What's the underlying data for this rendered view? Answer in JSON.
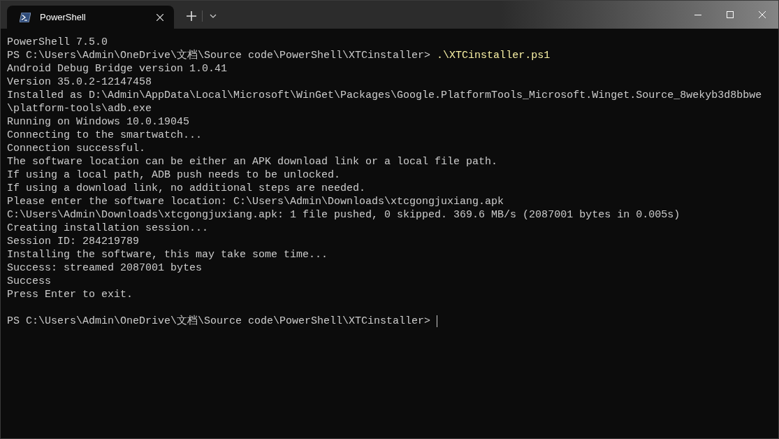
{
  "tabs": [
    {
      "title": "PowerShell",
      "selected": true
    }
  ],
  "terminal": {
    "lines": [
      {
        "kind": "output",
        "text": "PowerShell 7.5.0"
      },
      {
        "kind": "prompt",
        "prompt": "PS C:\\Users\\Admin\\OneDrive\\文档\\Source code\\PowerShell\\XTCinstaller> ",
        "command": ".\\XTCinstaller.ps1",
        "cursor": false
      },
      {
        "kind": "output",
        "text": "Android Debug Bridge version 1.0.41"
      },
      {
        "kind": "output",
        "text": "Version 35.0.2-12147458"
      },
      {
        "kind": "output",
        "text": "Installed as D:\\Admin\\AppData\\Local\\Microsoft\\WinGet\\Packages\\Google.PlatformTools_Microsoft.Winget.Source_8wekyb3d8bbwe"
      },
      {
        "kind": "output",
        "text": "\\platform-tools\\adb.exe"
      },
      {
        "kind": "output",
        "text": "Running on Windows 10.0.19045"
      },
      {
        "kind": "output",
        "text": "Connecting to the smartwatch..."
      },
      {
        "kind": "output",
        "text": "Connection successful."
      },
      {
        "kind": "output",
        "text": "The software location can be either an APK download link or a local file path."
      },
      {
        "kind": "output",
        "text": "If using a local path, ADB push needs to be unlocked."
      },
      {
        "kind": "output",
        "text": "If using a download link, no additional steps are needed."
      },
      {
        "kind": "output",
        "text": "Please enter the software location: C:\\Users\\Admin\\Downloads\\xtcgongjuxiang.apk"
      },
      {
        "kind": "output",
        "text": "C:\\Users\\Admin\\Downloads\\xtcgongjuxiang.apk: 1 file pushed, 0 skipped. 369.6 MB/s (2087001 bytes in 0.005s)"
      },
      {
        "kind": "output",
        "text": "Creating installation session..."
      },
      {
        "kind": "output",
        "text": "Session ID: 284219789"
      },
      {
        "kind": "output",
        "text": "Installing the software, this may take some time..."
      },
      {
        "kind": "output",
        "text": "Success: streamed 2087001 bytes"
      },
      {
        "kind": "output",
        "text": "Success"
      },
      {
        "kind": "output",
        "text": "Press Enter to exit."
      },
      {
        "kind": "blank"
      },
      {
        "kind": "prompt",
        "prompt": "PS C:\\Users\\Admin\\OneDrive\\文档\\Source code\\PowerShell\\XTCinstaller> ",
        "cursor": true
      }
    ]
  }
}
